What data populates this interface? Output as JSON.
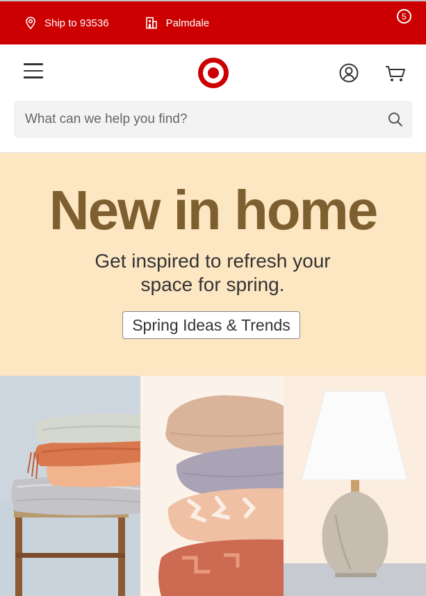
{
  "topbar": {
    "ship_label": "Ship to 93536",
    "store_label": "Palmdale",
    "background": "#cc0000"
  },
  "header": {
    "logo_icon": "target-bullseye-icon",
    "menu_icon": "hamburger-menu-icon",
    "account_icon": "account-icon",
    "cart_icon": "cart-icon",
    "cart_count": "5"
  },
  "search": {
    "placeholder": "What can we help you find?",
    "icon": "search-icon"
  },
  "hero": {
    "title": "New in home",
    "subtitle": "Get inspired to refresh your space for spring.",
    "cta_label": "Spring Ideas & Trends",
    "background": "#fde6c2",
    "title_color": "#7d5f30"
  },
  "tiles": [
    {
      "subject": "stacked throw blankets on a bench"
    },
    {
      "subject": "stack of decorative pillows"
    },
    {
      "subject": "ceramic table lamp with white shade"
    }
  ]
}
